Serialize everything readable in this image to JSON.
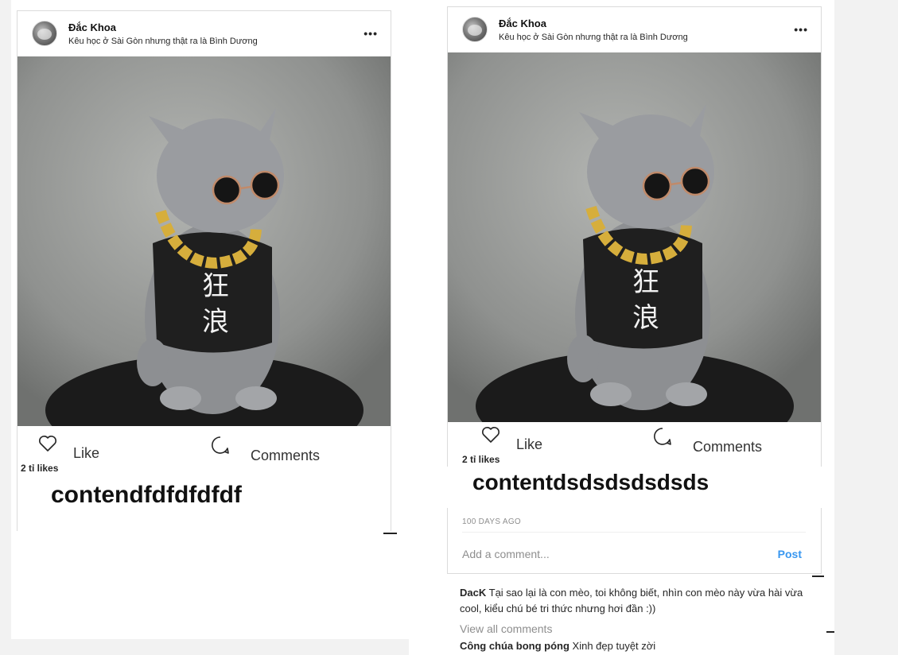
{
  "colors": {
    "accent": "#3897f0",
    "text": "#262626",
    "muted": "#8e8e8e",
    "border": "#dbdbdb"
  },
  "posts": [
    {
      "user": {
        "name": "Đắc Khoa",
        "location": "Kêu học ở Sài Gòn nhưng thật ra là Bình Dương",
        "avatar_icon": "user-avatar"
      },
      "more_icon": "more-horizontal-icon",
      "image": {
        "subject": "cat",
        "shirt_text_1": "狂",
        "shirt_text_2": "浪"
      },
      "actions": {
        "like_icon": "heart-icon",
        "like_label": "Like",
        "comment_icon": "comment-bubble-icon",
        "comment_label": "Comments"
      },
      "likes": "2 tỉ likes",
      "content": "contendfdfdfdfdf"
    },
    {
      "user": {
        "name": "Đắc Khoa",
        "location": "Kêu học ở Sài Gòn nhưng thật ra là Bình Dương",
        "avatar_icon": "user-avatar"
      },
      "more_icon": "more-horizontal-icon",
      "image": {
        "subject": "cat",
        "shirt_text_1": "狂",
        "shirt_text_2": "浪"
      },
      "actions": {
        "like_icon": "heart-icon",
        "like_label": "Like",
        "comment_icon": "comment-bubble-icon",
        "comment_label": "Comments"
      },
      "likes": "2 tỉ likes",
      "content": "contentdsdsdsdsdsds",
      "timestamp": "100 DAYS AGO",
      "add_comment": {
        "placeholder": "Add a comment...",
        "post_label": "Post"
      },
      "comments": [
        {
          "author": "DacK",
          "text": "Tại sao lại là con mèo, toi không biết, nhìn con mèo này vừa hài vừa cool, kiểu chú bé tri thức nhưng hơi đần :))"
        },
        {
          "author": "Công chúa bong póng",
          "text": "Xinh đẹp tuyệt zời"
        }
      ],
      "view_all_label": "View all comments"
    }
  ]
}
